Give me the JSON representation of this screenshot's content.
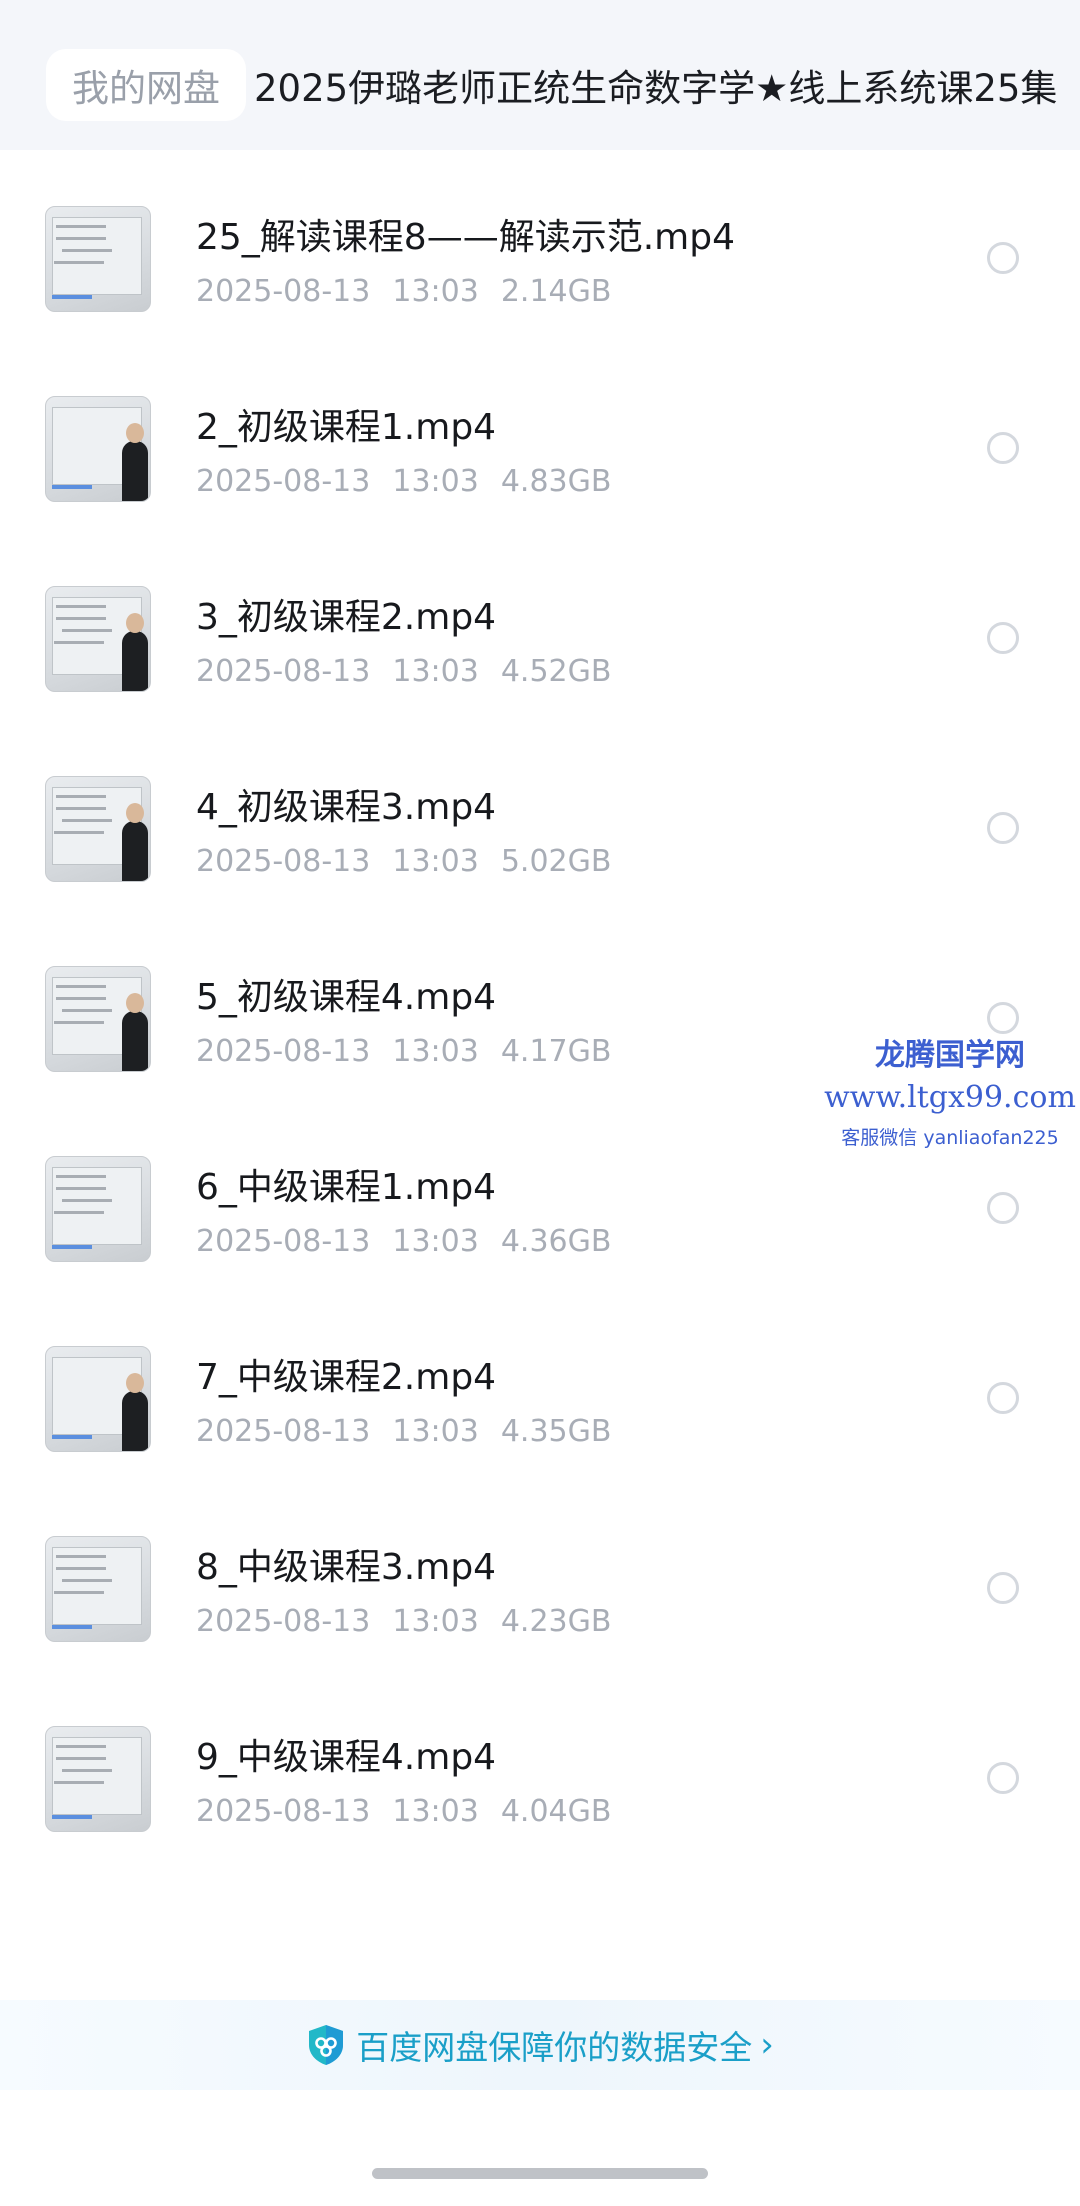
{
  "header": {
    "root_label": "我的网盘",
    "current_folder": "2025伊璐老师正统生命数字学★线上系统课25集"
  },
  "files": [
    {
      "name": "25_解读课程8——解读示范.mp4",
      "date": "2025-08-13",
      "time": "13:03",
      "size": "2.14GB"
    },
    {
      "name": "2_初级课程1.mp4",
      "date": "2025-08-13",
      "time": "13:03",
      "size": "4.83GB"
    },
    {
      "name": "3_初级课程2.mp4",
      "date": "2025-08-13",
      "time": "13:03",
      "size": "4.52GB"
    },
    {
      "name": "4_初级课程3.mp4",
      "date": "2025-08-13",
      "time": "13:03",
      "size": "5.02GB"
    },
    {
      "name": "5_初级课程4.mp4",
      "date": "2025-08-13",
      "time": "13:03",
      "size": "4.17GB"
    },
    {
      "name": "6_中级课程1.mp4",
      "date": "2025-08-13",
      "time": "13:03",
      "size": "4.36GB"
    },
    {
      "name": "7_中级课程2.mp4",
      "date": "2025-08-13",
      "time": "13:03",
      "size": "4.35GB"
    },
    {
      "name": "8_中级课程3.mp4",
      "date": "2025-08-13",
      "time": "13:03",
      "size": "4.23GB"
    },
    {
      "name": "9_中级课程4.mp4",
      "date": "2025-08-13",
      "time": "13:03",
      "size": "4.04GB"
    }
  ],
  "watermark": {
    "title": "龙腾国学网",
    "url": "www.ltgx99.com",
    "contact": "客服微信 yanliaofan225"
  },
  "security": {
    "text": "百度网盘保障你的数据安全",
    "icon": "shield-icon",
    "accent_color": "#1a9fc8"
  }
}
